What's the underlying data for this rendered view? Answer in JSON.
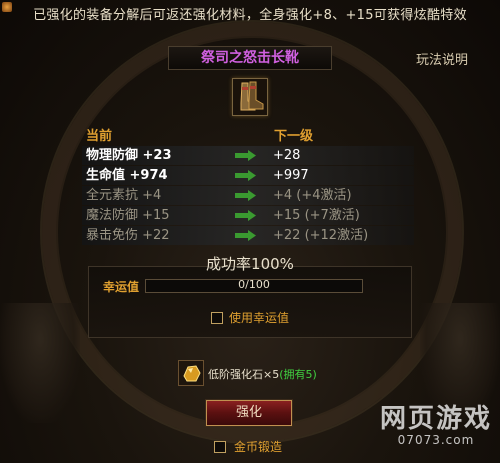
{
  "header": {
    "notice": "已强化的装备分解后可返还强化材料，全身强化+8、+15可获得炫酷特效",
    "rules_link": "玩法说明"
  },
  "item": {
    "name": "祭司之怒击长靴",
    "name_color": "#d060e0",
    "icon": "boots-icon"
  },
  "columns": {
    "current": "当前",
    "next": "下一级"
  },
  "stats": [
    {
      "current": "物理防御 +23",
      "next": "+28",
      "active": true
    },
    {
      "current": "生命值 +974",
      "next": "+997",
      "active": true
    },
    {
      "current": "全元素抗 +4",
      "next": "+4 (+4激活)",
      "active": false
    },
    {
      "current": "魔法防御 +15",
      "next": "+15 (+7激活)",
      "active": false
    },
    {
      "current": "暴击免伤 +22",
      "next": "+22 (+12激活)",
      "active": false
    }
  ],
  "success_rate": "成功率100%",
  "luck": {
    "label": "幸运值",
    "value_text": "0/100",
    "fraction": 0,
    "use_label": "使用幸运值",
    "use_checked": false
  },
  "material": {
    "icon": "strengthen-stone-icon",
    "text": "低阶强化石×5",
    "owned": "(拥有5)",
    "owned_color": "#40d040"
  },
  "actions": {
    "strengthen_label": "强化",
    "gold_forge_label": "金币锻造",
    "gold_forge_checked": false
  },
  "watermark": {
    "main": "网页游戏",
    "sub": "07073.com"
  },
  "colors": {
    "accent_orange": "#e0a030",
    "active_text": "#ffffff",
    "inactive_text": "#9a9484",
    "arrow_green": "#3a9a30"
  }
}
